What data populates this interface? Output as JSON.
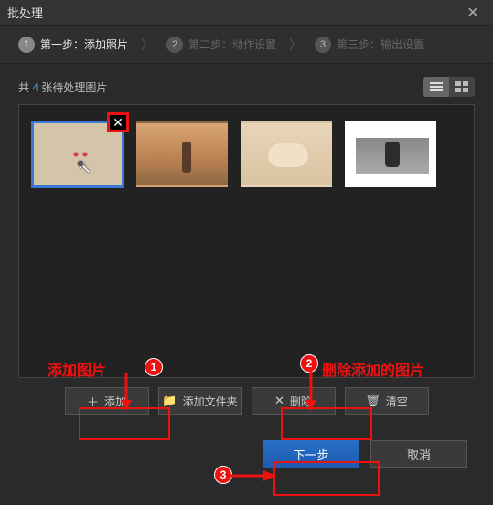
{
  "window": {
    "title": "批处理"
  },
  "steps": [
    {
      "num": "1",
      "label": "第一步：添加照片",
      "active": true
    },
    {
      "num": "2",
      "label": "第二步：动作设置",
      "active": false
    },
    {
      "num": "3",
      "label": "第三步：输出设置",
      "active": false
    }
  ],
  "count": {
    "prefix": "共 ",
    "n": "4",
    "suffix": " 张待处理图片"
  },
  "buttons": {
    "add": "添加",
    "add_folder": "添加文件夹",
    "delete": "删除",
    "clear": "清空",
    "next": "下一步",
    "cancel": "取消"
  },
  "annotations": {
    "label_add": "添加图片",
    "label_delete": "删除添加的图片",
    "badge1": "1",
    "badge2": "2",
    "badge3": "3"
  },
  "colors": {
    "accent": "#e11",
    "primary": "#2a6fc9",
    "link": "#4aa3df"
  }
}
